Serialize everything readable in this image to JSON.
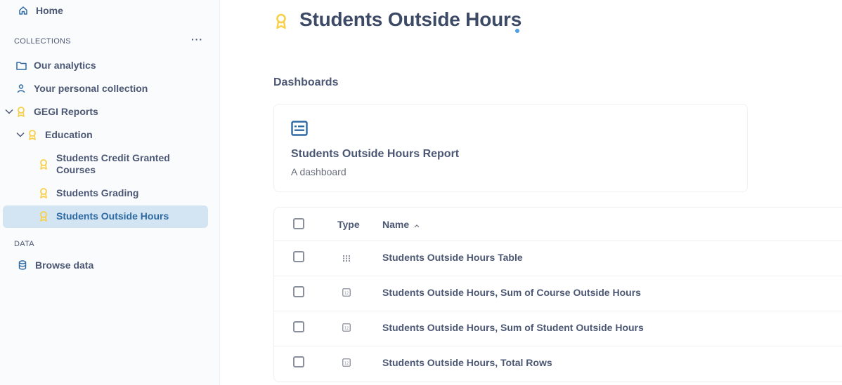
{
  "sidebar": {
    "home": "Home",
    "collections_label": "COLLECTIONS",
    "more": "···",
    "items": [
      {
        "label": "Our analytics"
      },
      {
        "label": "Your personal collection"
      },
      {
        "label": "GEGI Reports"
      },
      {
        "label": "Education"
      },
      {
        "label": "Students Credit Granted Courses"
      },
      {
        "label": "Students Grading"
      },
      {
        "label": "Students Outside Hours"
      }
    ],
    "data_label": "DATA",
    "browse": "Browse data"
  },
  "main": {
    "title": "Students Outside Hours",
    "dashboards_heading": "Dashboards",
    "card": {
      "title": "Students Outside Hours Report",
      "subtitle": "A dashboard"
    },
    "table": {
      "col_type": "Type",
      "col_name": "Name",
      "sort_indicator": "^",
      "rows": [
        {
          "type": "table-icon",
          "name": "Students Outside Hours Table"
        },
        {
          "type": "number-icon",
          "name": "Students Outside Hours, Sum of Course Outside Hours"
        },
        {
          "type": "number-icon",
          "name": "Students Outside Hours, Sum of Student Outside Hours"
        },
        {
          "type": "number-icon",
          "name": "Students Outside Hours, Total Rows"
        }
      ]
    }
  },
  "colors": {
    "official_badge": "#f9cf48",
    "accent": "#509ee3",
    "selected_bg": "#d3e4f2"
  }
}
